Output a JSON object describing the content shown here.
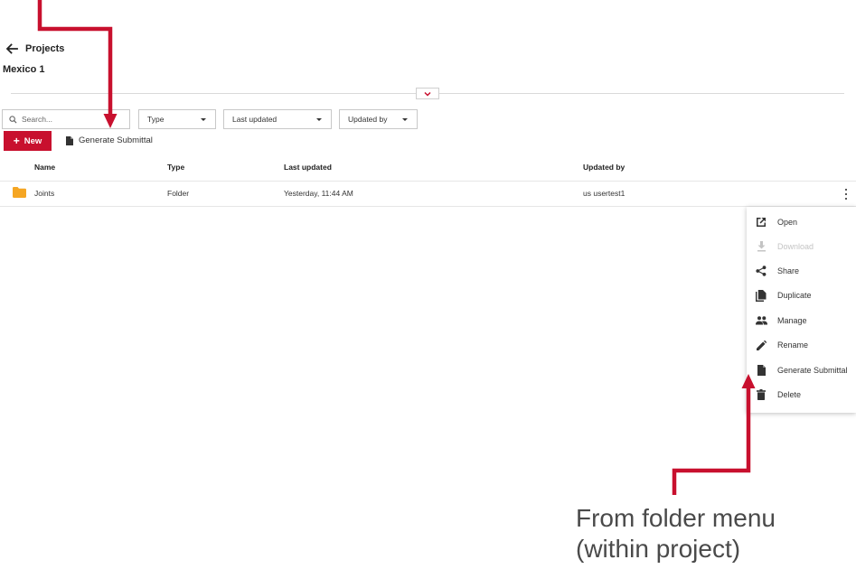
{
  "header": {
    "back_label": "Projects",
    "project_name": "Mexico 1"
  },
  "filters": {
    "search_placeholder": "Search...",
    "type_label": "Type",
    "last_updated_label": "Last updated",
    "updated_by_label": "Updated by"
  },
  "toolbar": {
    "new_label": "New",
    "generate_label": "Generate Submittal"
  },
  "table": {
    "columns": [
      "Name",
      "Type",
      "Last updated",
      "Updated by"
    ],
    "rows": [
      {
        "name": "Joints",
        "type": "Folder",
        "last_updated": "Yesterday, 11:44 AM",
        "updated_by": "us usertest1"
      }
    ]
  },
  "context_menu": {
    "items": [
      {
        "label": "Open",
        "icon": "open-external-icon",
        "disabled": false
      },
      {
        "label": "Download",
        "icon": "download-icon",
        "disabled": true
      },
      {
        "label": "Share",
        "icon": "share-icon",
        "disabled": false
      },
      {
        "label": "Duplicate",
        "icon": "duplicate-icon",
        "disabled": false
      },
      {
        "label": "Manage",
        "icon": "manage-users-icon",
        "disabled": false
      },
      {
        "label": "Rename",
        "icon": "pencil-icon",
        "disabled": false
      },
      {
        "label": "Generate Submittal",
        "icon": "document-icon",
        "disabled": false
      },
      {
        "label": "Delete",
        "icon": "trash-icon",
        "disabled": false
      }
    ]
  },
  "annotation": {
    "line1": "From folder menu",
    "line2": "(within project)"
  },
  "colors": {
    "accent": "#c8102e",
    "folder": "#f5a623",
    "annotation_arrow": "#c8102e"
  }
}
